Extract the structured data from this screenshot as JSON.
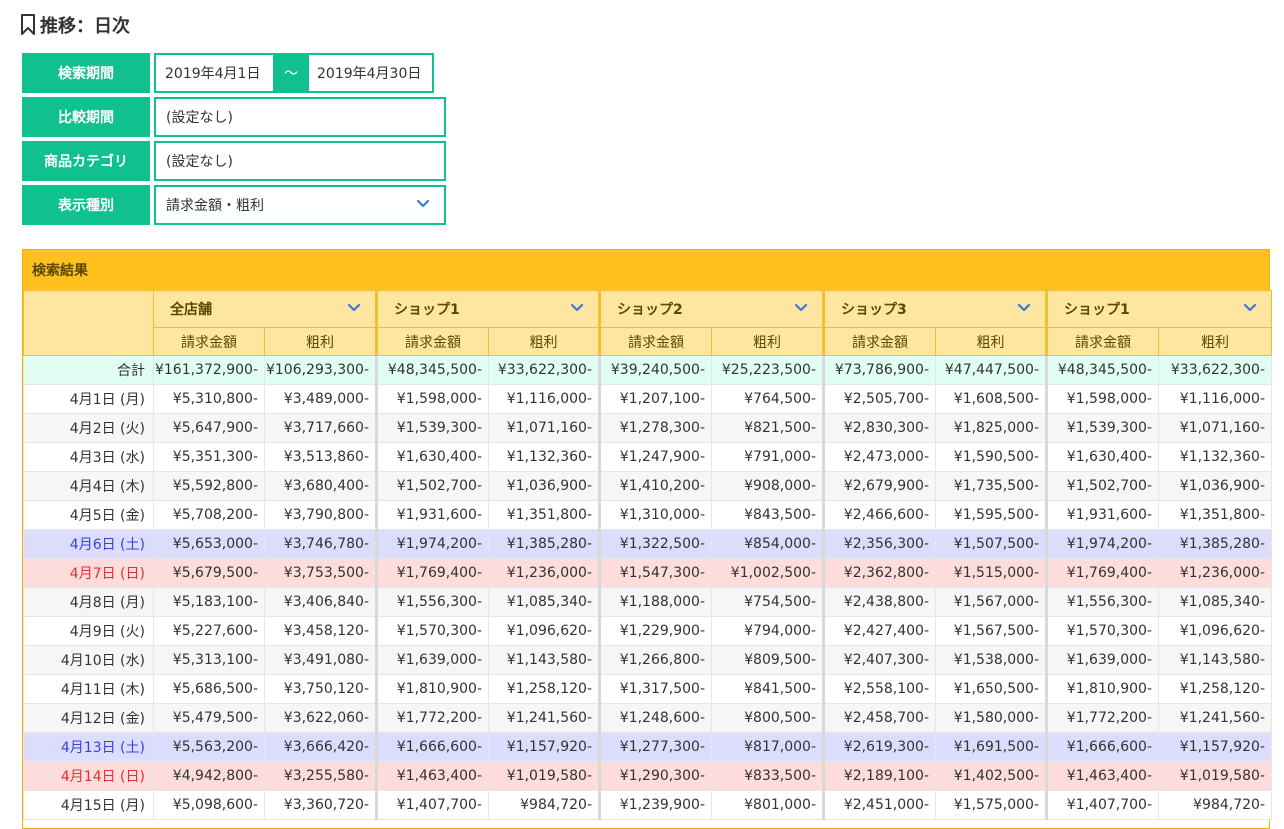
{
  "page": {
    "title": "推移：日次",
    "icon": "bookmark-icon"
  },
  "filters": {
    "period_label": "検索期間",
    "period_from": "2019年4月1日",
    "period_sep": "〜",
    "period_to": "2019年4月30日",
    "compare_label": "比較期間",
    "compare_value": "(設定なし)",
    "category_label": "商品カテゴリ",
    "category_value": "(設定なし)",
    "type_label": "表示種別",
    "type_value": "請求金額・粗利"
  },
  "results": {
    "title": "検索結果",
    "shops": [
      "全店舗",
      "ショップ1",
      "ショップ2",
      "ショップ3",
      "ショップ1"
    ],
    "sub_headers": [
      "請求金額",
      "粗利"
    ],
    "rows": [
      {
        "label": "合計",
        "kind": "total",
        "values": [
          "¥161,372,900-",
          "¥106,293,300-",
          "¥48,345,500-",
          "¥33,622,300-",
          "¥39,240,500-",
          "¥25,223,500-",
          "¥73,786,900-",
          "¥47,447,500-",
          "¥48,345,500-",
          "¥33,622,300-"
        ]
      },
      {
        "label": "4月1日 (月)",
        "kind": "odd",
        "values": [
          "¥5,310,800-",
          "¥3,489,000-",
          "¥1,598,000-",
          "¥1,116,000-",
          "¥1,207,100-",
          "¥764,500-",
          "¥2,505,700-",
          "¥1,608,500-",
          "¥1,598,000-",
          "¥1,116,000-"
        ]
      },
      {
        "label": "4月2日 (火)",
        "kind": "even",
        "values": [
          "¥5,647,900-",
          "¥3,717,660-",
          "¥1,539,300-",
          "¥1,071,160-",
          "¥1,278,300-",
          "¥821,500-",
          "¥2,830,300-",
          "¥1,825,000-",
          "¥1,539,300-",
          "¥1,071,160-"
        ]
      },
      {
        "label": "4月3日 (水)",
        "kind": "odd",
        "values": [
          "¥5,351,300-",
          "¥3,513,860-",
          "¥1,630,400-",
          "¥1,132,360-",
          "¥1,247,900-",
          "¥791,000-",
          "¥2,473,000-",
          "¥1,590,500-",
          "¥1,630,400-",
          "¥1,132,360-"
        ]
      },
      {
        "label": "4月4日 (木)",
        "kind": "even",
        "values": [
          "¥5,592,800-",
          "¥3,680,400-",
          "¥1,502,700-",
          "¥1,036,900-",
          "¥1,410,200-",
          "¥908,000-",
          "¥2,679,900-",
          "¥1,735,500-",
          "¥1,502,700-",
          "¥1,036,900-"
        ]
      },
      {
        "label": "4月5日 (金)",
        "kind": "odd",
        "values": [
          "¥5,708,200-",
          "¥3,790,800-",
          "¥1,931,600-",
          "¥1,351,800-",
          "¥1,310,000-",
          "¥843,500-",
          "¥2,466,600-",
          "¥1,595,500-",
          "¥1,931,600-",
          "¥1,351,800-"
        ]
      },
      {
        "label": "4月6日 (土)",
        "kind": "sat",
        "values": [
          "¥5,653,000-",
          "¥3,746,780-",
          "¥1,974,200-",
          "¥1,385,280-",
          "¥1,322,500-",
          "¥854,000-",
          "¥2,356,300-",
          "¥1,507,500-",
          "¥1,974,200-",
          "¥1,385,280-"
        ]
      },
      {
        "label": "4月7日 (日)",
        "kind": "sun",
        "values": [
          "¥5,679,500-",
          "¥3,753,500-",
          "¥1,769,400-",
          "¥1,236,000-",
          "¥1,547,300-",
          "¥1,002,500-",
          "¥2,362,800-",
          "¥1,515,000-",
          "¥1,769,400-",
          "¥1,236,000-"
        ]
      },
      {
        "label": "4月8日 (月)",
        "kind": "even",
        "values": [
          "¥5,183,100-",
          "¥3,406,840-",
          "¥1,556,300-",
          "¥1,085,340-",
          "¥1,188,000-",
          "¥754,500-",
          "¥2,438,800-",
          "¥1,567,000-",
          "¥1,556,300-",
          "¥1,085,340-"
        ]
      },
      {
        "label": "4月9日 (火)",
        "kind": "odd",
        "values": [
          "¥5,227,600-",
          "¥3,458,120-",
          "¥1,570,300-",
          "¥1,096,620-",
          "¥1,229,900-",
          "¥794,000-",
          "¥2,427,400-",
          "¥1,567,500-",
          "¥1,570,300-",
          "¥1,096,620-"
        ]
      },
      {
        "label": "4月10日 (水)",
        "kind": "even",
        "values": [
          "¥5,313,100-",
          "¥3,491,080-",
          "¥1,639,000-",
          "¥1,143,580-",
          "¥1,266,800-",
          "¥809,500-",
          "¥2,407,300-",
          "¥1,538,000-",
          "¥1,639,000-",
          "¥1,143,580-"
        ]
      },
      {
        "label": "4月11日 (木)",
        "kind": "odd",
        "values": [
          "¥5,686,500-",
          "¥3,750,120-",
          "¥1,810,900-",
          "¥1,258,120-",
          "¥1,317,500-",
          "¥841,500-",
          "¥2,558,100-",
          "¥1,650,500-",
          "¥1,810,900-",
          "¥1,258,120-"
        ]
      },
      {
        "label": "4月12日 (金)",
        "kind": "even",
        "values": [
          "¥5,479,500-",
          "¥3,622,060-",
          "¥1,772,200-",
          "¥1,241,560-",
          "¥1,248,600-",
          "¥800,500-",
          "¥2,458,700-",
          "¥1,580,000-",
          "¥1,772,200-",
          "¥1,241,560-"
        ]
      },
      {
        "label": "4月13日 (土)",
        "kind": "sat",
        "values": [
          "¥5,563,200-",
          "¥3,666,420-",
          "¥1,666,600-",
          "¥1,157,920-",
          "¥1,277,300-",
          "¥817,000-",
          "¥2,619,300-",
          "¥1,691,500-",
          "¥1,666,600-",
          "¥1,157,920-"
        ]
      },
      {
        "label": "4月14日 (日)",
        "kind": "sun",
        "values": [
          "¥4,942,800-",
          "¥3,255,580-",
          "¥1,463,400-",
          "¥1,019,580-",
          "¥1,290,300-",
          "¥833,500-",
          "¥2,189,100-",
          "¥1,402,500-",
          "¥1,463,400-",
          "¥1,019,580-"
        ]
      },
      {
        "label": "4月15日 (月)",
        "kind": "odd",
        "values": [
          "¥5,098,600-",
          "¥3,360,720-",
          "¥1,407,700-",
          "¥984,720-",
          "¥1,239,900-",
          "¥801,000-",
          "¥2,451,000-",
          "¥1,575,000-",
          "¥1,407,700-",
          "¥984,720-"
        ]
      }
    ]
  },
  "colors": {
    "accent": "#10c08e",
    "results_header": "#ffc020",
    "column_header": "#ffe6a0",
    "saturday": "#dcdcfc",
    "sunday": "#fddcdc",
    "total": "#e0fff2"
  }
}
